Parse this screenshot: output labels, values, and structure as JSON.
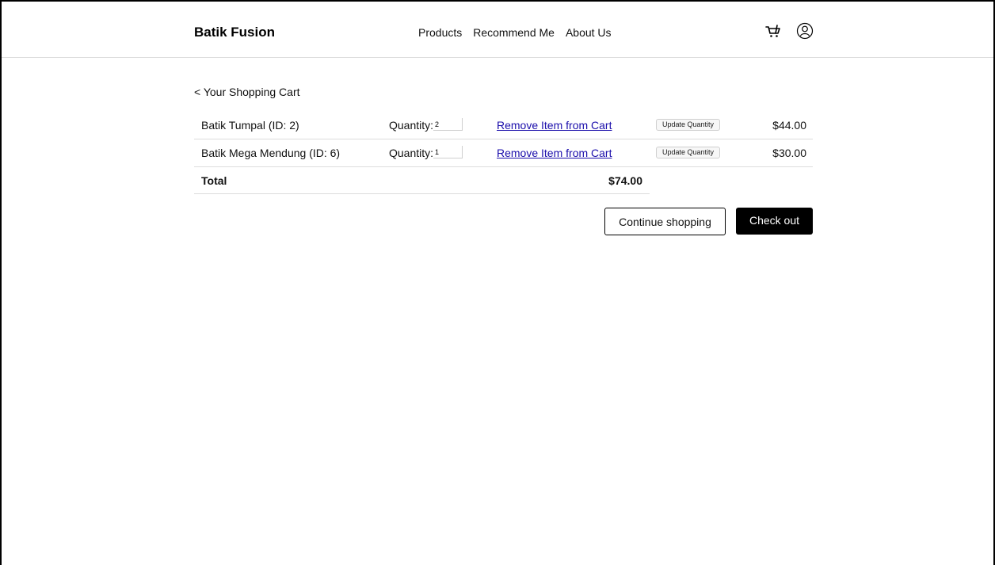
{
  "header": {
    "brand": "Batik Fusion",
    "nav": [
      "Products",
      "Recommend Me",
      "About Us"
    ],
    "icons": [
      "cart-icon",
      "user-icon"
    ]
  },
  "page": {
    "back_link": "< Your Shopping Cart"
  },
  "cart": {
    "quantity_label": "Quantity:",
    "remove_label": "Remove Item from Cart",
    "update_label": "Update Quantity",
    "items": [
      {
        "name": "Batik Tumpal (ID: 2)",
        "quantity": "2",
        "price": "$44.00"
      },
      {
        "name": "Batik Mega Mendung (ID: 6)",
        "quantity": "1",
        "price": "$30.00"
      }
    ],
    "total_label": "Total",
    "total_value": "$74.00"
  },
  "actions": {
    "continue_label": "Continue shopping",
    "checkout_label": "Check out"
  },
  "colors": {
    "link": "#1a0dab",
    "primary_button": "#000000"
  }
}
